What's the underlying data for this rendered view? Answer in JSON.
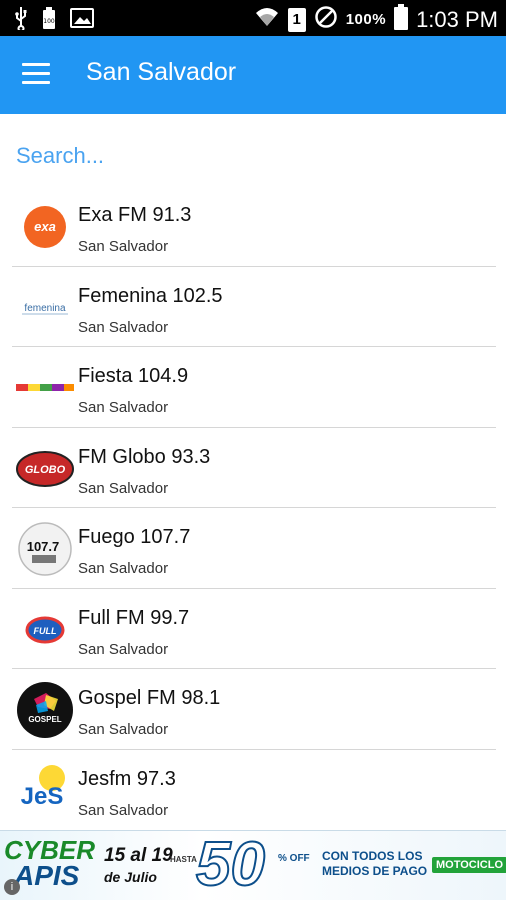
{
  "status_bar": {
    "left_icons": [
      "usb-icon",
      "battery-small-icon",
      "image-icon"
    ],
    "right_icons": [
      "wifi-icon",
      "sim-icon",
      "no-disturb-icon",
      "battery-icon"
    ],
    "sim_slot": "1",
    "battery_percent": "100%",
    "time": "1:03 PM"
  },
  "app_bar": {
    "menu_icon": "hamburger-menu-icon",
    "title": "San Salvador",
    "color": "#2196f3"
  },
  "search": {
    "placeholder": "Search..."
  },
  "stations": [
    {
      "name": "Exa FM 91.3",
      "city": "San Salvador",
      "logo_text": "exa"
    },
    {
      "name": "Femenina 102.5",
      "city": "San Salvador",
      "logo_text": "femenina"
    },
    {
      "name": "Fiesta 104.9",
      "city": "San Salvador",
      "logo_text": ""
    },
    {
      "name": "FM Globo 93.3",
      "city": "San Salvador",
      "logo_text": "GLOBO"
    },
    {
      "name": "Fuego 107.7",
      "city": "San Salvador",
      "logo_text": "107.7"
    },
    {
      "name": "Full FM 99.7",
      "city": "San Salvador",
      "logo_text": "FULL"
    },
    {
      "name": "Gospel FM 98.1",
      "city": "San Salvador",
      "logo_text": "GOSPEL"
    },
    {
      "name": "Jesfm 97.3",
      "city": "San Salvador",
      "logo_text": "JeS"
    }
  ],
  "ad": {
    "brand_line1": "CYBER",
    "brand_line2": "APIS",
    "dates": "15 al 19",
    "hasta": "HASTA",
    "month": "de Julio",
    "discount": "50",
    "off": "% OFF",
    "payment": "CON TODOS LOS MEDIOS DE PAGO",
    "tag": "MOTOCICLO",
    "info_icon": "info-icon"
  }
}
